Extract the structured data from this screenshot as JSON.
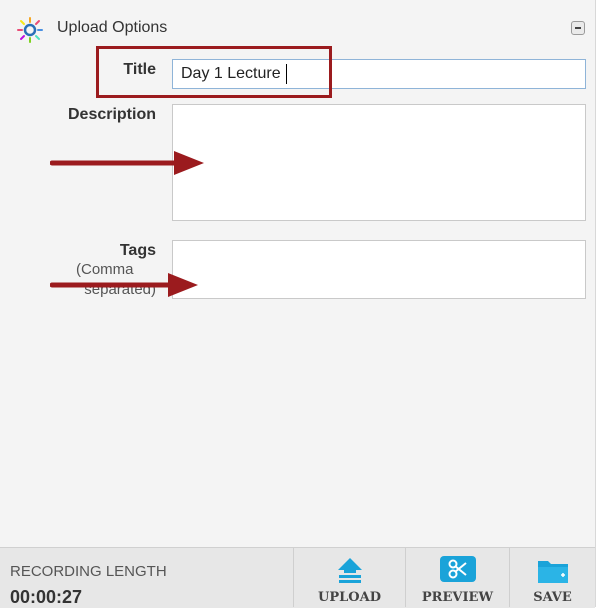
{
  "panel": {
    "title": "Upload Options"
  },
  "form": {
    "title_label": "Title",
    "title_value": "Day 1 Lecture",
    "description_label": "Description",
    "description_value": "",
    "tags_label": "Tags",
    "tags_hint_line1": "(Comma",
    "tags_hint_line2": "separated)",
    "tags_value": ""
  },
  "footer": {
    "recording_length_label": "RECORDING LENGTH",
    "recording_length_value": "00:00:27",
    "buttons": [
      {
        "label": "UPLOAD",
        "icon": "upload-icon"
      },
      {
        "label": "PREVIEW",
        "icon": "scissors-icon"
      },
      {
        "label": "SAVE",
        "icon": "folder-icon"
      }
    ]
  },
  "colors": {
    "accent": "#1aa3d9",
    "annotation": "#9b1b1e",
    "panel_bg": "#f4f4f4"
  }
}
